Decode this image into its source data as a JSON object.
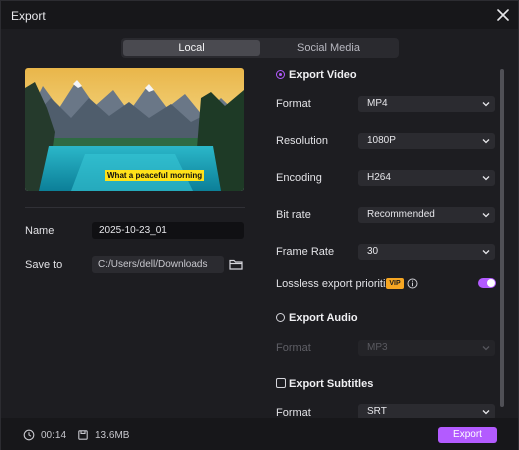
{
  "window": {
    "title": "Export"
  },
  "tabs": [
    {
      "label": "Local"
    },
    {
      "label": "Social Media"
    }
  ],
  "preview": {
    "caption": "What a peaceful morning"
  },
  "left": {
    "name_label": "Name",
    "name_value": "2025-10-23_01",
    "save_to_label": "Save to",
    "save_to_value": "C:/Users/dell/Downloads"
  },
  "export_video": {
    "heading": "Export Video",
    "selected": true,
    "rows": [
      {
        "label": "Format",
        "value": "MP4"
      },
      {
        "label": "Resolution",
        "value": "1080P"
      },
      {
        "label": "Encoding",
        "value": "H264"
      },
      {
        "label": "Bit rate",
        "value": "Recommended"
      },
      {
        "label": "Frame Rate",
        "value": "30"
      }
    ],
    "lossless_label": "Lossless export prioritized",
    "vip_badge": "VIP",
    "lossless_enabled": true
  },
  "export_audio": {
    "heading": "Export Audio",
    "selected": false,
    "format_label": "Format",
    "format_value": "MP3"
  },
  "export_subtitles": {
    "heading": "Export Subtitles",
    "checked": false,
    "format_label": "Format",
    "format_value": "SRT"
  },
  "footer": {
    "duration": "00:14",
    "size": "13.6MB",
    "export_label": "Export"
  },
  "colors": {
    "accent": "#b35bff",
    "vip": "#f5a623",
    "background": "#1d1d21"
  },
  "icons": [
    "close-icon",
    "folder-icon",
    "chevron-down-icon",
    "info-icon",
    "clock-icon",
    "file-size-icon"
  ]
}
